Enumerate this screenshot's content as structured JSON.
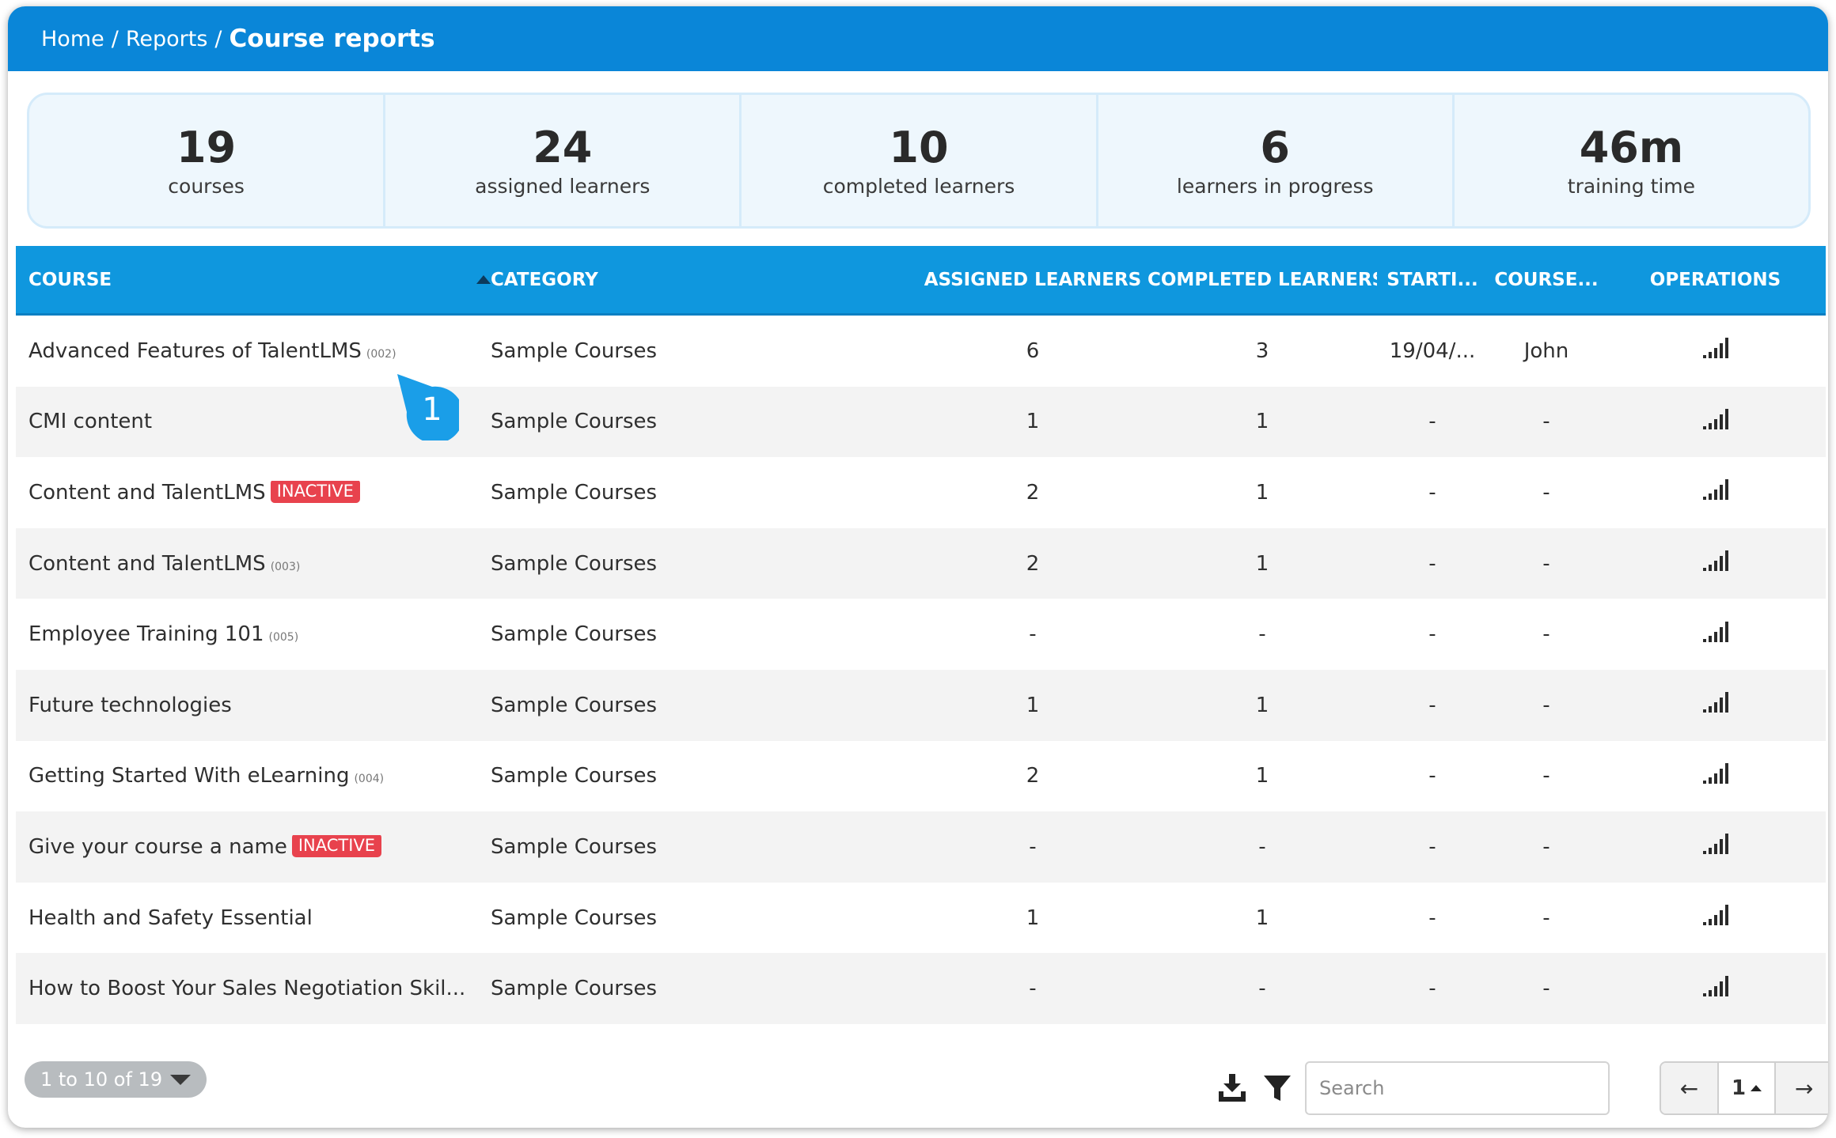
{
  "breadcrumb": {
    "home": "Home",
    "reports": "Reports",
    "current": "Course reports",
    "separator": "/"
  },
  "stats": [
    {
      "value": "19",
      "label": "courses"
    },
    {
      "value": "24",
      "label": "assigned learners"
    },
    {
      "value": "10",
      "label": "completed learners"
    },
    {
      "value": "6",
      "label": "learners in progress"
    },
    {
      "value": "46m",
      "label": "training time"
    }
  ],
  "table": {
    "columns": {
      "course": "COURSE",
      "category": "CATEGORY",
      "assigned": "ASSIGNED LEARNERS",
      "completed": "COMPLETED LEARNERS",
      "start": "STARTI...",
      "course_owner": "COURSE...",
      "operations": "OPERATIONS"
    },
    "rows": [
      {
        "name": "Advanced Features of TalentLMS",
        "code": "(002)",
        "badge": "",
        "category": "Sample Courses",
        "assigned": "6",
        "completed": "3",
        "start": "19/04/...",
        "course_owner": "John"
      },
      {
        "name": "CMI content",
        "code": "",
        "badge": "",
        "category": "Sample Courses",
        "assigned": "1",
        "completed": "1",
        "start": "-",
        "course_owner": "-"
      },
      {
        "name": "Content and TalentLMS",
        "code": "",
        "badge": "INACTIVE",
        "category": "Sample Courses",
        "assigned": "2",
        "completed": "1",
        "start": "-",
        "course_owner": "-"
      },
      {
        "name": "Content and TalentLMS",
        "code": "(003)",
        "badge": "",
        "category": "Sample Courses",
        "assigned": "2",
        "completed": "1",
        "start": "-",
        "course_owner": "-"
      },
      {
        "name": "Employee Training 101",
        "code": "(005)",
        "badge": "",
        "category": "Sample Courses",
        "assigned": "-",
        "completed": "-",
        "start": "-",
        "course_owner": "-"
      },
      {
        "name": "Future technologies",
        "code": "",
        "badge": "",
        "category": "Sample Courses",
        "assigned": "1",
        "completed": "1",
        "start": "-",
        "course_owner": "-"
      },
      {
        "name": "Getting Started With eLearning",
        "code": "(004)",
        "badge": "",
        "category": "Sample Courses",
        "assigned": "2",
        "completed": "1",
        "start": "-",
        "course_owner": "-"
      },
      {
        "name": "Give your course a name",
        "code": "",
        "badge": "INACTIVE",
        "category": "Sample Courses",
        "assigned": "-",
        "completed": "-",
        "start": "-",
        "course_owner": "-"
      },
      {
        "name": "Health and Safety Essential",
        "code": "",
        "badge": "",
        "category": "Sample Courses",
        "assigned": "1",
        "completed": "1",
        "start": "-",
        "course_owner": "-"
      },
      {
        "name": "How to Boost Your Sales Negotiation Skil...",
        "code": "",
        "badge": "",
        "category": "Sample Courses",
        "assigned": "-",
        "completed": "-",
        "start": "-",
        "course_owner": "-"
      }
    ]
  },
  "marker": {
    "number": "1",
    "color": "#1a9ee8"
  },
  "footer": {
    "range": "1 to 10 of 19",
    "search_placeholder": "Search",
    "prev": "←",
    "page": "1",
    "next": "→"
  },
  "colors": {
    "header": "#0a86d8",
    "table_header": "#0f97de",
    "inactive_badge": "#e8424d"
  },
  "icons": {
    "operations": "bar-chart-icon",
    "download": "download-icon",
    "filter": "filter-icon",
    "sort": "sort-asc-icon"
  }
}
